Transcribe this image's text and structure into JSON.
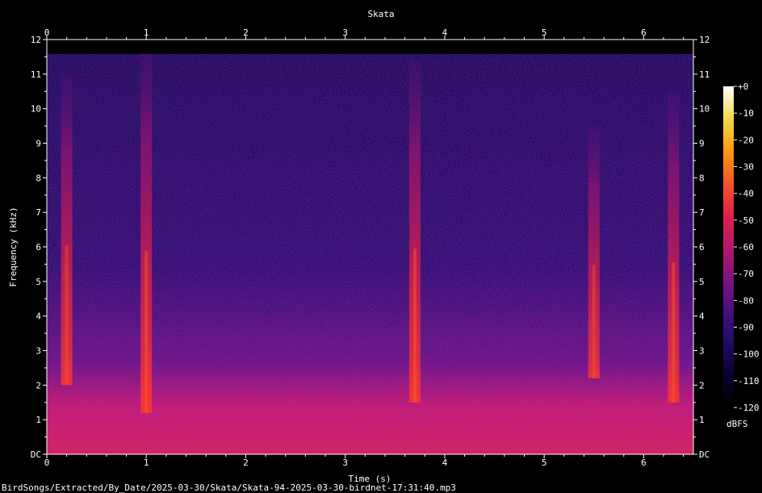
{
  "chart_data": {
    "type": "heatmap",
    "title": "Skata",
    "xlabel": "Time (s)",
    "ylabel": "Frequency (kHz)",
    "xlim": [
      0,
      6.5
    ],
    "ylim": [
      0,
      12
    ],
    "x_ticks": [
      "0",
      "1",
      "2",
      "3",
      "4",
      "5",
      "6"
    ],
    "y_ticks": [
      "DC",
      "1",
      "2",
      "3",
      "4",
      "5",
      "6",
      "7",
      "8",
      "9",
      "10",
      "11",
      "12"
    ],
    "colorbar": {
      "label": "dBFS",
      "range": [
        -120,
        0
      ],
      "ticks": [
        "+0",
        "-10",
        "-20",
        "-30",
        "-40",
        "-50",
        "-60",
        "-70",
        "-80",
        "-90",
        "-100",
        "-110",
        "-120"
      ],
      "colors": [
        "#000000",
        "#0b0030",
        "#1f0b63",
        "#4a0e7e",
        "#7d1382",
        "#b5176b",
        "#e3214a",
        "#f55626",
        "#fb9a10",
        "#f5d84a",
        "#ffffff"
      ]
    },
    "background_level_dbfs": -95,
    "low_band_level_dbfs": -60,
    "bright_events": [
      {
        "t": 0.2,
        "f_low": 2.0,
        "f_high": 11.0,
        "level_dbfs": -65
      },
      {
        "t": 1.0,
        "f_low": 1.2,
        "f_high": 11.6,
        "level_dbfs": -55
      },
      {
        "t": 3.7,
        "f_low": 1.5,
        "f_high": 11.4,
        "level_dbfs": -55
      },
      {
        "t": 5.5,
        "f_low": 2.2,
        "f_high": 9.5,
        "level_dbfs": -70
      },
      {
        "t": 6.3,
        "f_low": 1.5,
        "f_high": 10.5,
        "level_dbfs": -60
      }
    ]
  },
  "footer": {
    "file_path": "BirdSongs/Extracted/By_Date/2025-03-30/Skata/Skata-94-2025-03-30-birdnet-17:31:40.mp3"
  }
}
